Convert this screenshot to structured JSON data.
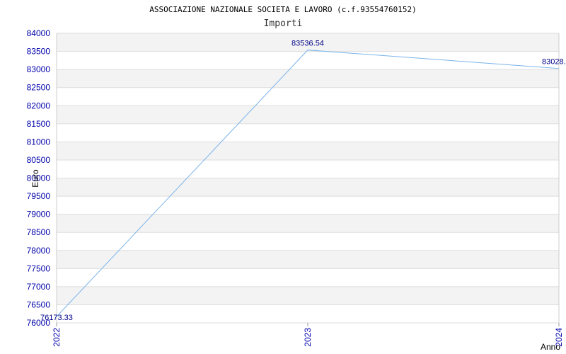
{
  "chart_data": {
    "type": "line",
    "title": "ASSOCIAZIONE NAZIONALE SOCIETA E LAVORO (c.f.93554760152)",
    "subtitle": "Importi",
    "xlabel": "Anno",
    "ylabel": "Euro",
    "x": [
      "2022",
      "2023",
      "2024"
    ],
    "values": [
      76173.33,
      83536.54,
      83028.0
    ],
    "labels": [
      "76173.33",
      "83536.54",
      "83028."
    ],
    "ylim": [
      76000,
      84000
    ],
    "ytick_step": 500,
    "grid": true,
    "colors": {
      "line": "#7ab4ea",
      "band": "#f3f3f3",
      "grid": "#dddddd",
      "tick": "#0000aa",
      "data_label": "#000088"
    }
  }
}
